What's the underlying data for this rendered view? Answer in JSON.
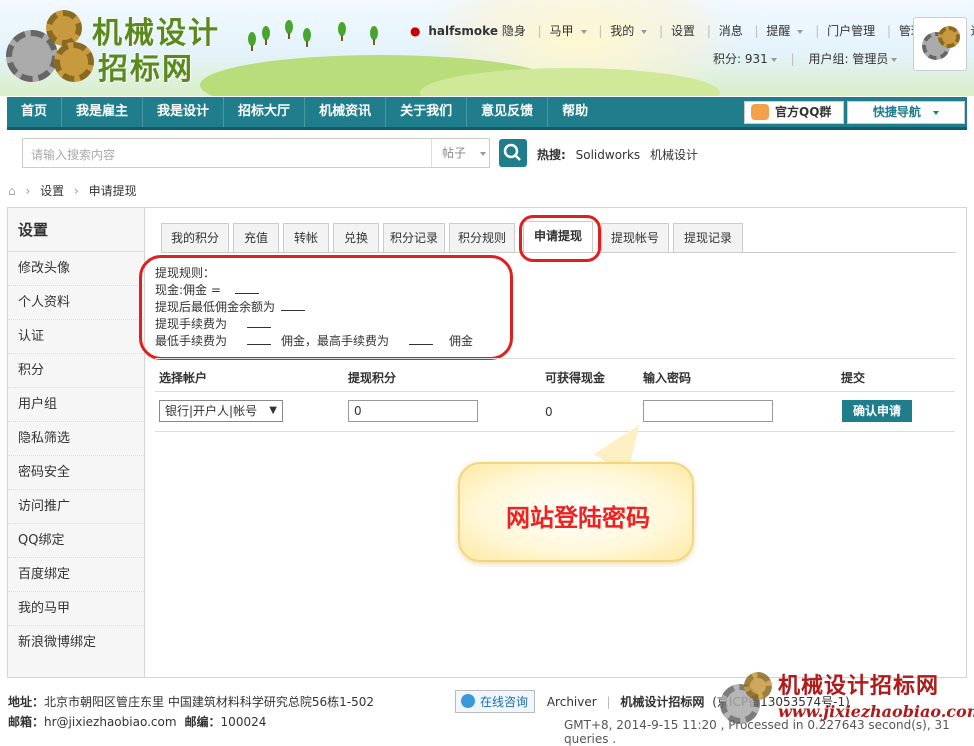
{
  "header": {
    "logo_line1": "机械设计",
    "logo_line2": "招标网",
    "username": "halfsmoke",
    "invisible": "隐身",
    "links": [
      "马甲",
      "我的",
      "设置",
      "消息",
      "提醒",
      "门户管理",
      "管理中心",
      "退出"
    ],
    "points": "积分: 931",
    "usergroup": "用户组: 管理员"
  },
  "nav": {
    "items": [
      "首页",
      "我是雇主",
      "我是设计",
      "招标大厅",
      "机械资讯",
      "关于我们",
      "意见反馈",
      "帮助"
    ],
    "qq_group": "官方QQ群",
    "quick_nav": "快捷导航"
  },
  "search": {
    "placeholder": "请输入搜索内容",
    "type": "帖子",
    "hot_label": "热搜:",
    "hot_terms": [
      "Solidworks",
      "机械设计"
    ]
  },
  "breadcrumb": [
    "设置",
    "申请提现"
  ],
  "sidebar": {
    "title": "设置",
    "items": [
      "修改头像",
      "个人资料",
      "认证",
      "积分",
      "用户组",
      "隐私筛选",
      "密码安全",
      "访问推广",
      "QQ绑定",
      "百度绑定",
      "我的马甲",
      "新浪微博绑定"
    ]
  },
  "tabs": [
    "我的积分",
    "充值",
    "转帐",
    "兑换",
    "积分记录",
    "积分规则",
    "申请提现",
    "提现帐号",
    "提现记录"
  ],
  "active_tab": "申请提现",
  "rules": {
    "title": "提现规则：",
    "line1": "现金:佣金 =",
    "line2": "提现后最低佣金余额为",
    "line3": "提现手续费为",
    "line4a": "最低手续费为",
    "line4b": "佣金，最高手续费为",
    "line4c": "佣金"
  },
  "table": {
    "headers": [
      "选择帐户",
      "提现积分",
      "可获得现金",
      "输入密码",
      "提交"
    ],
    "account_select": "银行|开户人|帐号",
    "points_value": "0",
    "cash_value": "0",
    "password_value": "",
    "submit": "确认申请"
  },
  "annotation": "网站登陆密码",
  "footer": {
    "address_label": "地址：",
    "address": "北京市朝阳区管庄东里 中国建筑材料科学研究总院56栋1-502",
    "email_label": "邮箱：",
    "email": "hr@jixiezhaobiao.com",
    "zip_label": "邮编：",
    "zip": "100024",
    "online": "在线咨询",
    "archiver": "Archiver",
    "site": "机械设计招标网",
    "icp": "(京ICP备13053574号-1)",
    "stats": "GMT+8, 2014-9-15 11:20 , Processed in 0.227643 second(s), 31 queries ."
  },
  "watermark": {
    "name": "机械设计招标网",
    "url": "www.jixiezhaobiao.com"
  }
}
